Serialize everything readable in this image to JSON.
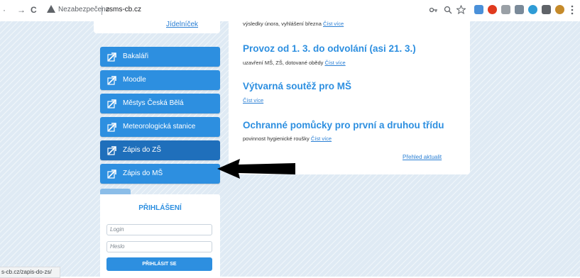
{
  "browser": {
    "nav_glyph": "·",
    "forward_glyph": "→",
    "reload_glyph": "C",
    "security_text": "Nezabezpečeno",
    "url": "zsms-cb.cz",
    "status_url": "s-cb.cz/zapis-do-zs/"
  },
  "sidebar": {
    "jidelnicek_link": "Jídelníček",
    "buttons": [
      {
        "label": "Bakaláři"
      },
      {
        "label": "Moodle"
      },
      {
        "label": "Městys Česká Bělá"
      },
      {
        "label": "Meteorologická stanice"
      },
      {
        "label": "Zápis do ZŠ"
      },
      {
        "label": "Zápis do MŠ"
      }
    ]
  },
  "login": {
    "title": "PŘIHLÁŠENÍ",
    "login_placeholder": "Login",
    "password_placeholder": "Heslo",
    "submit_label": "PŘIHLÁSIT SE"
  },
  "news": {
    "item0_text": "výsledky února, vyhlášení března",
    "read_more": "Číst více",
    "items": [
      {
        "title": "Provoz od 1. 3. do odvolání (asi 21. 3.)",
        "text": "uzavření MŠ, ZŠ, dotované obědy"
      },
      {
        "title": "Výtvarná soutěž pro MŠ",
        "text": ""
      },
      {
        "title": "Ochranné pomůcky pro první a druhou třídu",
        "text": "povinnost hygienické roušky"
      }
    ],
    "overview_link": "Přehled aktualit"
  }
}
